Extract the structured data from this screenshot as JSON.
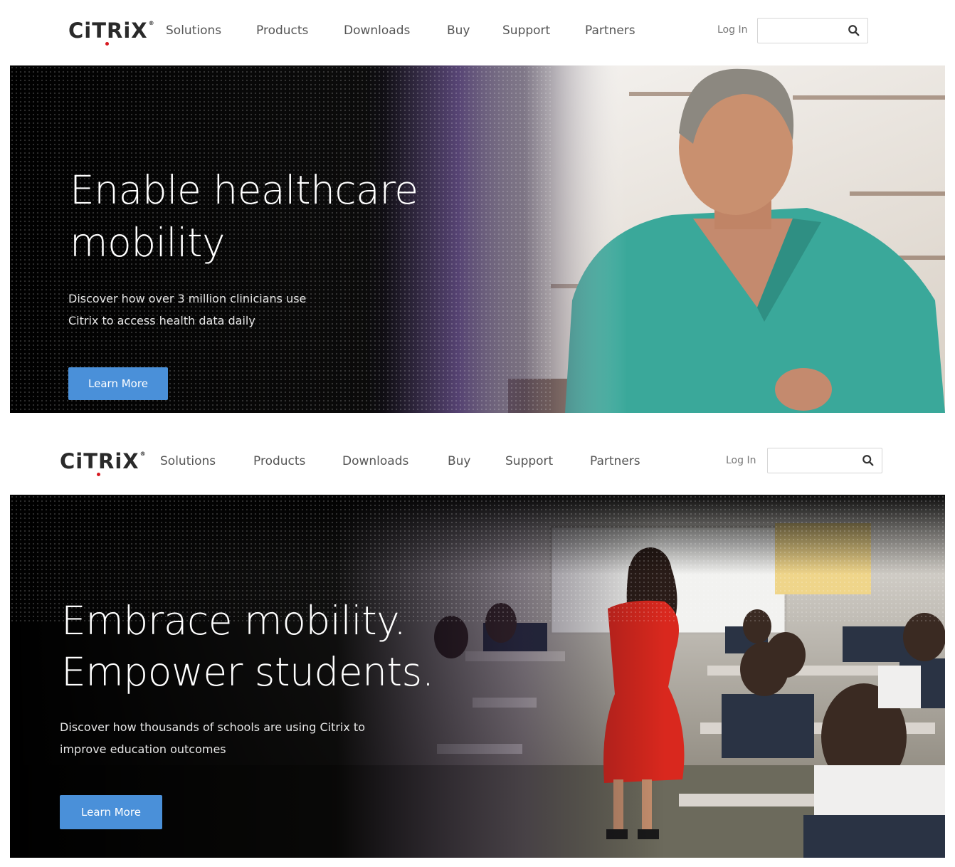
{
  "brand": {
    "logo_text": "CiTRiX",
    "trademark": "®"
  },
  "panels": [
    {
      "nav": [
        "Solutions",
        "Products",
        "Downloads",
        "Buy",
        "Support",
        "Partners"
      ],
      "login": "Log In",
      "search_placeholder": "",
      "hero": {
        "title_line1": "Enable healthcare",
        "title_line2": "mobility",
        "sub_line1": "Discover how over 3 million clinicians use",
        "sub_line2": "Citrix to access health data daily",
        "cta": "Learn More"
      }
    },
    {
      "nav": [
        "Solutions",
        "Products",
        "Downloads",
        "Buy",
        "Support",
        "Partners"
      ],
      "login": "Log In",
      "search_placeholder": "",
      "hero": {
        "title_line1": "Embrace mobility.",
        "title_line2": "Empower students.",
        "sub_line1": "Discover how thousands of schools are using Citrix to",
        "sub_line2": "improve education outcomes",
        "cta": "Learn More"
      }
    }
  ],
  "colors": {
    "cta": "#4a90d9",
    "logo_dot": "#d71920",
    "scrubs": "#3aa89a",
    "dress": "#d9281e"
  },
  "icons": {
    "search": "search-icon"
  }
}
